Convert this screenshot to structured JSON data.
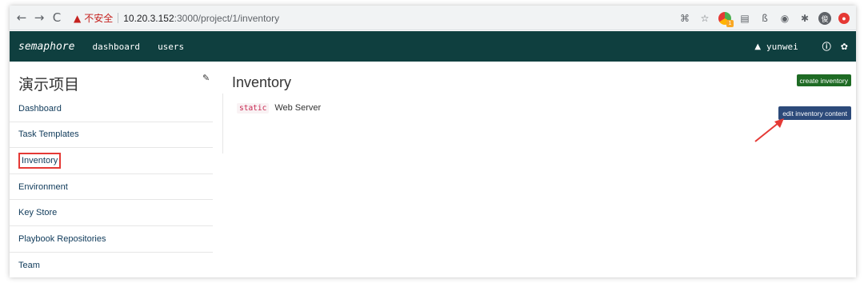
{
  "browser": {
    "insecure_label": "不安全",
    "url_host": "10.20.3.152",
    "url_path": ":3000/project/1/inventory",
    "profile_initial": "俊",
    "extension_badge": "1"
  },
  "appnav": {
    "brand": "semaphore",
    "links": [
      "dashboard",
      "users"
    ],
    "username": "yunwei"
  },
  "sidebar": {
    "project_title": "演示项目",
    "items": [
      {
        "label": "Dashboard"
      },
      {
        "label": "Task Templates"
      },
      {
        "label": "Inventory",
        "active": true
      },
      {
        "label": "Environment"
      },
      {
        "label": "Key Store"
      },
      {
        "label": "Playbook Repositories"
      },
      {
        "label": "Team"
      }
    ]
  },
  "main": {
    "title": "Inventory",
    "create_button": "create inventory",
    "inventories": [
      {
        "type": "static",
        "name": "Web Server",
        "edit_button": "edit inventory content"
      }
    ]
  },
  "colors": {
    "navbar_bg": "#0f3f3f",
    "create_button_bg": "#1e6b24",
    "edit_button_bg": "#2c4a7a",
    "highlight": "#e53935"
  },
  "icons": {
    "back": "back-arrow-icon",
    "forward": "forward-arrow-icon",
    "reload": "reload-icon",
    "warning": "warning-icon",
    "translate": "translate-icon",
    "star": "star-icon",
    "user": "user-icon",
    "info": "info-icon",
    "settings": "gear-icon",
    "edit": "edit-icon"
  }
}
